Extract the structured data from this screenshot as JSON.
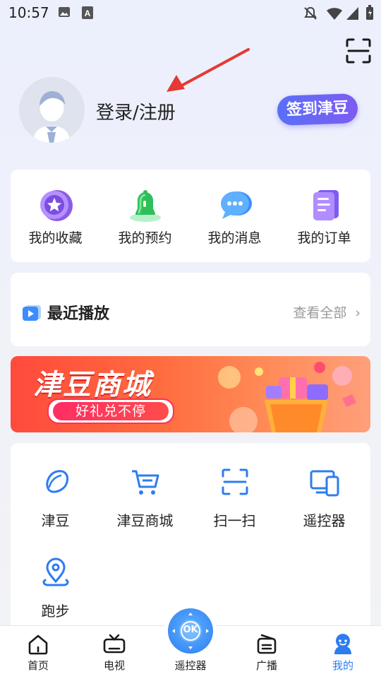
{
  "status_bar": {
    "time": "10:57"
  },
  "header": {
    "login_label": "登录/注册",
    "checkin_label": "签到津豆"
  },
  "quick_links": [
    {
      "label": "我的收藏",
      "icon": "star-badge-icon"
    },
    {
      "label": "我的预约",
      "icon": "bell-icon"
    },
    {
      "label": "我的消息",
      "icon": "chat-bubble-icon"
    },
    {
      "label": "我的订单",
      "icon": "order-list-icon"
    }
  ],
  "recent": {
    "title": "最近播放",
    "view_all": "查看全部"
  },
  "banner": {
    "title": "津豆商城",
    "subtitle": "好礼兑不停"
  },
  "tools": [
    {
      "label": "津豆",
      "icon": "bean-icon"
    },
    {
      "label": "津豆商城",
      "icon": "cart-icon"
    },
    {
      "label": "扫一扫",
      "icon": "scan-icon"
    },
    {
      "label": "遥控器",
      "icon": "devices-icon"
    },
    {
      "label": "跑步",
      "icon": "location-pin-icon"
    }
  ],
  "nav": [
    {
      "label": "首页",
      "icon": "home-icon"
    },
    {
      "label": "电视",
      "icon": "tv-icon"
    },
    {
      "label": "遥控器",
      "icon": "remote-ok-icon",
      "ok_text": "OK"
    },
    {
      "label": "广播",
      "icon": "radio-icon"
    },
    {
      "label": "我的",
      "icon": "profile-icon",
      "active": true
    }
  ],
  "colors": {
    "accent": "#2d7cf0",
    "checkin_start": "#5a6ff7",
    "checkin_end": "#7d5cf2",
    "banner": "#ff4a3c"
  }
}
